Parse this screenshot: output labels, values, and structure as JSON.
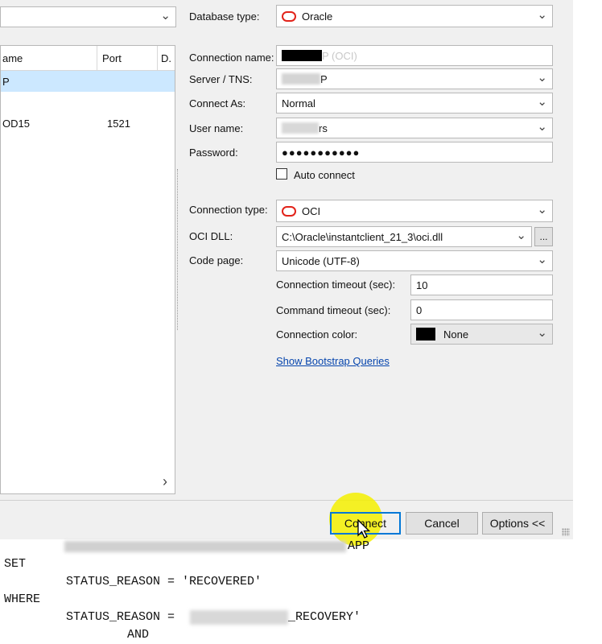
{
  "left": {
    "columns": [
      "ame",
      "Port",
      "D."
    ],
    "rows": [
      {
        "name": "P",
        "port": "",
        "d": ""
      },
      {
        "name": "",
        "port": "",
        "d": ""
      },
      {
        "name": "OD15",
        "port": "1521",
        "d": ""
      }
    ],
    "scroll_right_glyph": "›"
  },
  "form": {
    "database_type_label": "Database type:",
    "database_type_value": "Oracle",
    "connection_name_label": "Connection name:",
    "connection_name_suffix": "P (OCI)",
    "server_tns_label": "Server / TNS:",
    "server_tns_suffix": "P",
    "connect_as_label": "Connect As:",
    "connect_as_value": "Normal",
    "user_name_label": "User name:",
    "user_name_suffix": "rs",
    "password_label": "Password:",
    "password_mask": "●●●●●●●●●●●",
    "auto_connect_label": "Auto connect",
    "connection_type_label": "Connection type:",
    "connection_type_value": "OCI",
    "oci_dll_label": "OCI DLL:",
    "oci_dll_value": "C:\\Oracle\\instantclient_21_3\\oci.dll",
    "browse_label": "...",
    "code_page_label": "Code page:",
    "code_page_value": "Unicode (UTF-8)",
    "connection_timeout_label": "Connection timeout (sec):",
    "connection_timeout_value": "10",
    "command_timeout_label": "Command timeout (sec):",
    "command_timeout_value": "0",
    "connection_color_label": "Connection color:",
    "connection_color_value": "None",
    "connection_color_swatch": "#000000",
    "bootstrap_link": "Show Bootstrap Queries"
  },
  "buttons": {
    "connect": "Connect",
    "cancel": "Cancel",
    "options": "Options <<"
  },
  "sql": {
    "partial_line_tail": "APP",
    "set_kw": "SET",
    "set_line": "STATUS_REASON = 'RECOVERED'",
    "where_kw": "WHERE",
    "where_line_start": "STATUS_REASON =",
    "where_line_end": "_RECOVERY'",
    "and_kw": "AND"
  },
  "colors": {
    "oracle_red": "#e2231a",
    "link_blue": "#0645ad",
    "selected_row": "#cce8ff",
    "highlight_yellow": "#f5f000"
  }
}
